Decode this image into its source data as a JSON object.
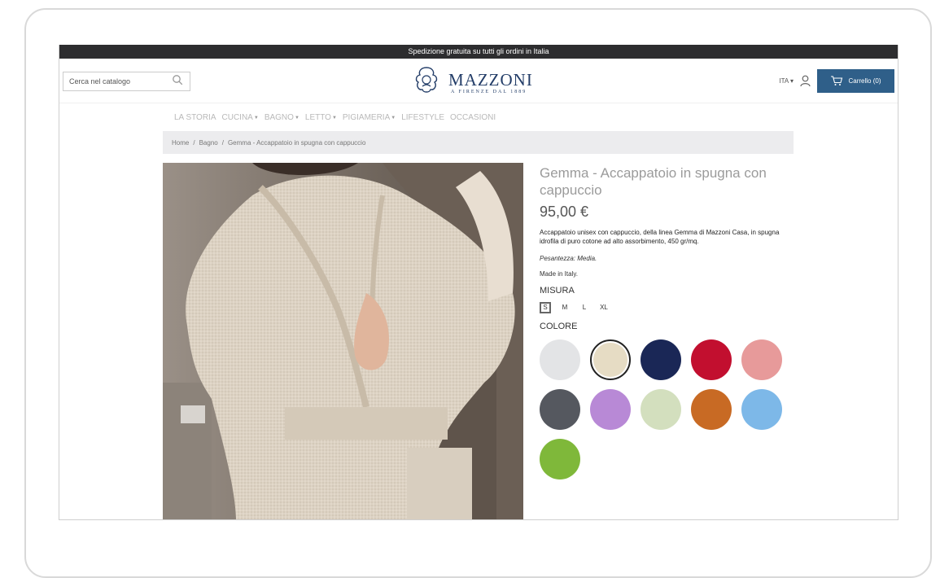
{
  "topbar": {
    "text": "Spedizione gratuita su tutti gli ordini in Italia"
  },
  "header": {
    "search_placeholder": "Cerca nel catalogo",
    "logo_name": "MAZZONI",
    "logo_tagline": "A FIRENZE DAL 1889",
    "language": "ITA ▾",
    "cart_label": "Carrello (0)"
  },
  "nav": {
    "items": [
      {
        "label": "LA STORIA",
        "dropdown": false
      },
      {
        "label": "CUCINA",
        "dropdown": true
      },
      {
        "label": "BAGNO",
        "dropdown": true
      },
      {
        "label": "LETTO",
        "dropdown": true
      },
      {
        "label": "PIGIAMERIA",
        "dropdown": true
      },
      {
        "label": "LIFESTYLE",
        "dropdown": false
      },
      {
        "label": "OCCASIONI",
        "dropdown": false
      }
    ]
  },
  "breadcrumb": {
    "home": "Home",
    "category": "Bagno",
    "current": "Gemma - Accappatoio in spugna con cappuccio",
    "separator": "/"
  },
  "product": {
    "title": "Gemma - Accappatoio in spugna con cappuccio",
    "price": "95,00 €",
    "description": "Accappatoio unisex con cappuccio, della linea Gemma di Mazzoni Casa, in spugna idrofila di puro cotone ad alto assorbimento, 450 gr/mq.",
    "weight": "Pesantezza: Media.",
    "made_in": "Made in Italy.",
    "size_label": "MISURA",
    "sizes": [
      "S",
      "M",
      "L",
      "XL"
    ],
    "selected_size": "S",
    "color_label": "COLORE",
    "colors": [
      "#e3e4e6",
      "#e6dcc4",
      "#1a2756",
      "#c20f2f",
      "#e79a9a",
      "#55585f",
      "#b889d6",
      "#d3dfbe",
      "#c86a24",
      "#7db8e8",
      "#7fb83a"
    ],
    "selected_color_index": 1
  }
}
